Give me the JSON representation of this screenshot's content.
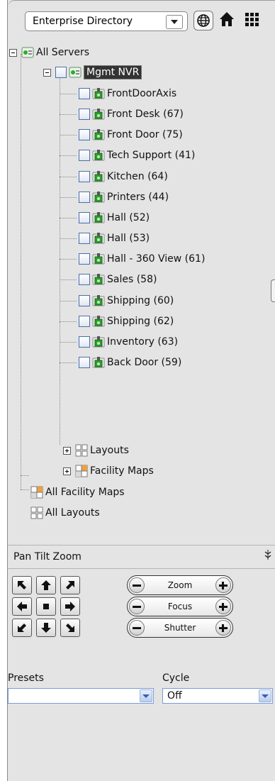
{
  "toolbar": {
    "directory_select": "Enterprise Directory",
    "icons": [
      "globe-icon",
      "home-icon",
      "grid-icon"
    ]
  },
  "tree": {
    "root": "All Servers",
    "server": "Mgmt NVR",
    "cameras": [
      "FrontDoorAxis",
      "Front Desk (67)",
      "Front Door (75)",
      "Tech Support (41)",
      "Kitchen (64)",
      "Printers (44)",
      "Hall (52)",
      "Hall (53)",
      "Hall - 360 View (61)",
      "Sales (58)",
      "Shipping (60)",
      "Shipping (62)",
      "Inventory (63)",
      "Back Door (59)"
    ],
    "layouts": "Layouts",
    "facility_maps": "Facility Maps",
    "all_facility_maps": "All Facility Maps",
    "all_layouts": "All Layouts"
  },
  "ptz": {
    "title": "Pan Tilt Zoom",
    "collapse_icon": "double-chevron-down-icon",
    "zoom_label": "Zoom",
    "focus_label": "Focus",
    "shutter_label": "Shutter",
    "presets_label": "Presets",
    "presets_value": "",
    "cycle_label": "Cycle",
    "cycle_value": "Off"
  },
  "colors": {
    "panel_bg": "#e4e4e4",
    "selected_bg": "#333333",
    "camera_icon_green": "#2e9e2e"
  }
}
